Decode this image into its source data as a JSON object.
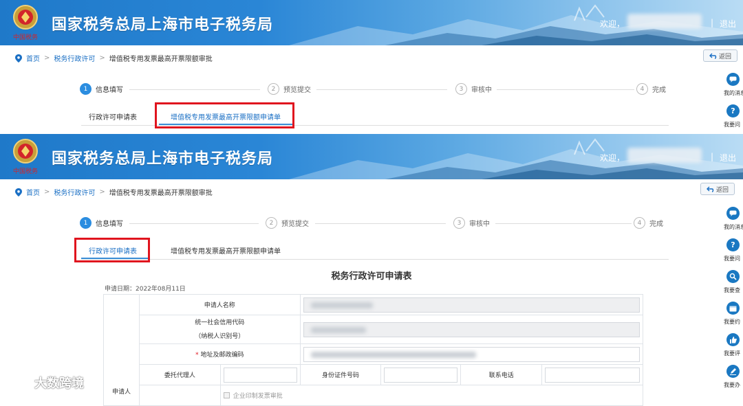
{
  "screens": [
    {
      "header": {
        "site_title": "国家税务总局上海市电子税务局",
        "welcome": "欢迎，",
        "separator": "|",
        "logout": "退出"
      },
      "breadcrumb": {
        "home": "首页",
        "level2": "税务行政许可",
        "current": "增值税专用发票最高开票限额审批"
      },
      "back_button": "返回",
      "steps": [
        {
          "num": "1",
          "label": "信息填写",
          "active": true
        },
        {
          "num": "2",
          "label": "预览提交",
          "active": false
        },
        {
          "num": "3",
          "label": "审核中",
          "active": false
        },
        {
          "num": "4",
          "label": "完成",
          "active": false
        }
      ],
      "tabs": [
        {
          "label": "行政许可申请表",
          "active": false
        },
        {
          "label": "增值税专用发票最高开票限额申请单",
          "active": true
        }
      ],
      "side_items": [
        "我的消息",
        "我要问"
      ]
    },
    {
      "header": {
        "site_title": "国家税务总局上海市电子税务局",
        "welcome": "欢迎，",
        "separator": "|",
        "logout": "退出"
      },
      "breadcrumb": {
        "home": "首页",
        "level2": "税务行政许可",
        "current": "增值税专用发票最高开票限额审批"
      },
      "back_button": "返回",
      "steps": [
        {
          "num": "1",
          "label": "信息填写",
          "active": true
        },
        {
          "num": "2",
          "label": "预览提交",
          "active": false
        },
        {
          "num": "3",
          "label": "审核中",
          "active": false
        },
        {
          "num": "4",
          "label": "完成",
          "active": false
        }
      ],
      "tabs": [
        {
          "label": "行政许可申请表",
          "active": true
        },
        {
          "label": "增值税专用发票最高开票限额申请单",
          "active": false
        }
      ],
      "side_items": [
        "我的消息",
        "我要问",
        "我要查",
        "我要约",
        "我要评",
        "我要办"
      ],
      "form": {
        "title": "税务行政许可申请表",
        "date": "申请日期：2022年08月11日",
        "section_label": "申请人",
        "applicant_name_label": "申请人名称",
        "credit_code_label": "统一社会信用代码",
        "taxpayer_id_label": "（纳税人识别号）",
        "address_label": "地址及邮政编码",
        "required_mark": "*",
        "agent_label": "委托代理人",
        "id_number_label": "身份证件号码",
        "phone_label": "联系电话",
        "checkbox_label": "企业印制发票审批"
      }
    }
  ],
  "watermark": "大数跨境",
  "colors": {
    "banner_start": "#1f79c9",
    "link": "#1a6fc4",
    "step_active": "#2b8de0",
    "highlight_box": "#e0141e",
    "side_icon": "#1a78c2"
  }
}
